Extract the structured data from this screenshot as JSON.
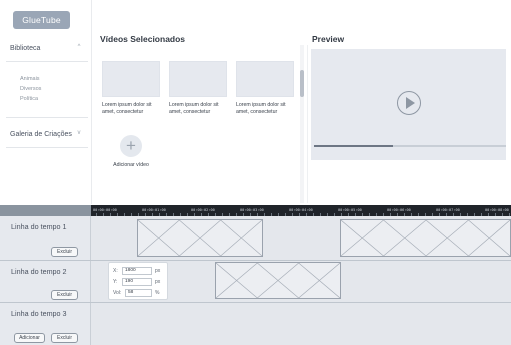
{
  "app": {
    "logo": "GlueTube"
  },
  "sidebar": {
    "library": {
      "label": "Biblioteca",
      "chevron": "^"
    },
    "library_items": [
      "Animais",
      "Diversos",
      "Política"
    ],
    "gallery": {
      "label": "Galeria de Criações",
      "chevron": "v"
    }
  },
  "selected": {
    "title": "Vídeos Selecionados",
    "cards": [
      {
        "text": "Lorem ipsum dolor sit amet, consectetur"
      },
      {
        "text": "Lorem ipsum dolor sit amet, consectetur"
      },
      {
        "text": "Lorem ipsum dolor sit amet, consectetur"
      }
    ],
    "add_label": "Adicionar vídeo"
  },
  "preview": {
    "title": "Preview",
    "progress": 0.41
  },
  "timeline": {
    "ticks": [
      "00:00:00:00",
      "00:00:01:00",
      "00:00:02:00",
      "00:00:03:00",
      "00:00:04:00",
      "00:00:05:00",
      "00:00:06:00",
      "00:00:07:00",
      "00:00:08:00"
    ],
    "tracks": [
      {
        "name": "Linha do tempo 1",
        "delete_label": "Excluir"
      },
      {
        "name": "Linha do tempo 2",
        "delete_label": "Excluir"
      },
      {
        "name": "Linha do tempo 3",
        "add_label": "Adicionar",
        "delete_label": "Excluir"
      }
    ]
  },
  "transform": {
    "x": {
      "label": "X:",
      "value": "1800",
      "unit": "px"
    },
    "y": {
      "label": "Y:",
      "value": "190",
      "unit": "px"
    },
    "vol": {
      "label": "Vol:",
      "value": "58",
      "unit": "%"
    }
  },
  "colors": {
    "accent": "#9aa6b6",
    "ruler": "#20242a",
    "track": "#e4e7ec"
  }
}
